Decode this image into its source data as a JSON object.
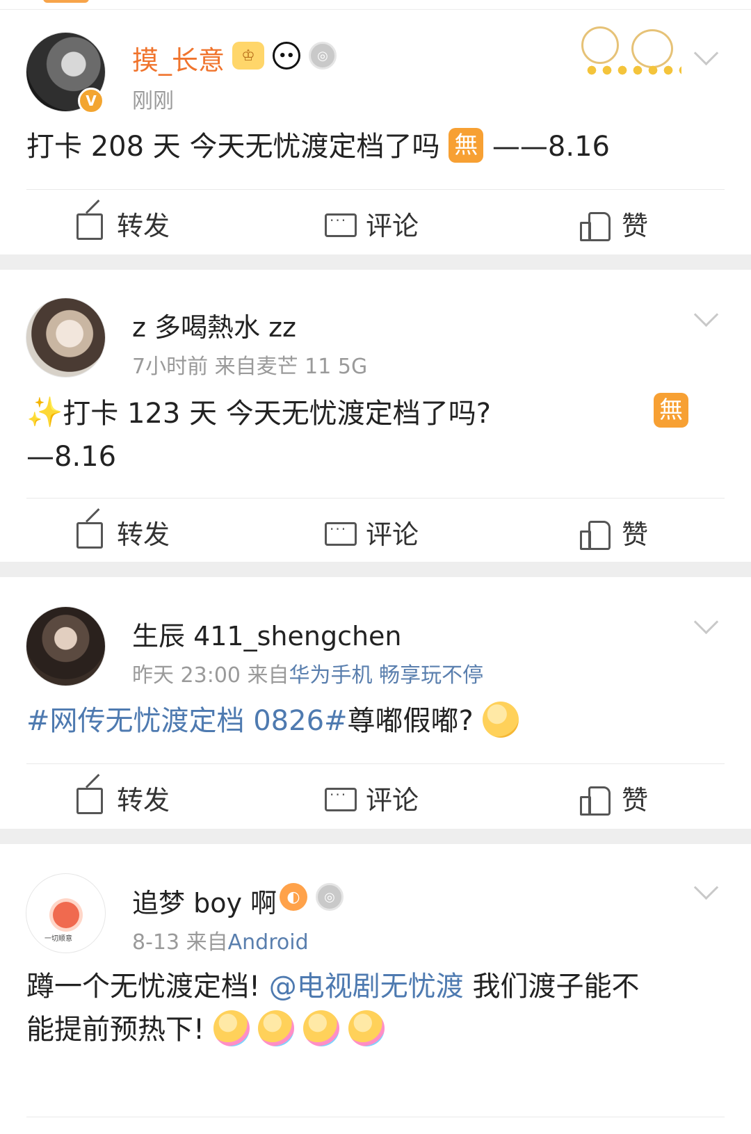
{
  "posts": [
    {
      "username": "摸_长意",
      "time": "刚刚",
      "content": {
        "pre": "打卡 208 天  今天无忧渡定档了吗 ",
        "emoji": "無",
        "post": " ——8.16"
      },
      "badges": [
        "crown-badge",
        "panda-badge",
        "medal-badge"
      ]
    },
    {
      "username": "z 多喝熱水 zz",
      "time": "7小时前",
      "source": "来自麦芒 11 5G",
      "content": {
        "sparkle": "✨",
        "pre": "打卡 123 天     今天无忧渡定档了吗?",
        "emoji": "無",
        "line2": "—8.16"
      }
    },
    {
      "username": "生辰 411_shengchen",
      "time": "昨天 23:00",
      "source_prefix": "来自",
      "source_link": "华为手机 畅享玩不停",
      "content": {
        "topic": "#网传无忧渡定档 0826#",
        "text": "尊嘟假嘟?"
      }
    },
    {
      "username": "追梦 boy 啊",
      "time": "8-13",
      "source_prefix": "来自",
      "source_link": "Android",
      "avatar_caption": "一切顺意",
      "content": {
        "line1_pre": "蹲一个无忧渡定档!",
        "mention": "@电视剧无忧渡",
        "line1_post": " 我们渡子能不",
        "line2": "能提前预热下!"
      },
      "badges": [
        "fish-badge",
        "medal-badge"
      ]
    }
  ],
  "actions": {
    "repost": "转发",
    "comment": "评论",
    "like": "赞"
  },
  "verified_badge": "V",
  "colors": {
    "username_vip": "#f0742d",
    "link": "#4e7ab0",
    "meta": "#9a9a9a",
    "separator": "#eeeeee",
    "emoji_box": "#f7a033"
  }
}
